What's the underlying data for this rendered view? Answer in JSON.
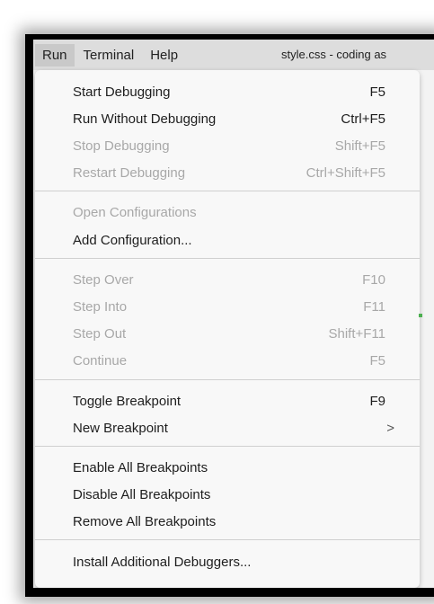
{
  "menubar": {
    "items": [
      "Run",
      "Terminal",
      "Help"
    ],
    "window_title": "style.css - coding as"
  },
  "run_menu": {
    "items": [
      {
        "label": "Start Debugging",
        "shortcut": "F5",
        "disabled": false
      },
      {
        "label": "Run Without Debugging",
        "shortcut": "Ctrl+F5",
        "disabled": false
      },
      {
        "label": "Stop Debugging",
        "shortcut": "Shift+F5",
        "disabled": true
      },
      {
        "label": "Restart Debugging",
        "shortcut": "Ctrl+Shift+F5",
        "disabled": true
      },
      {
        "label": "Open Configurations",
        "shortcut": "",
        "disabled": true
      },
      {
        "label": "Add Configuration...",
        "shortcut": "",
        "disabled": false
      },
      {
        "label": "Step Over",
        "shortcut": "F10",
        "disabled": true
      },
      {
        "label": "Step Into",
        "shortcut": "F11",
        "disabled": true
      },
      {
        "label": "Step Out",
        "shortcut": "Shift+F11",
        "disabled": true
      },
      {
        "label": "Continue",
        "shortcut": "F5",
        "disabled": true
      },
      {
        "label": "Toggle Breakpoint",
        "shortcut": "F9",
        "disabled": false
      },
      {
        "label": "New Breakpoint",
        "submenu_indicator": ">",
        "disabled": false
      },
      {
        "label": "Enable All Breakpoints",
        "shortcut": "",
        "disabled": false
      },
      {
        "label": "Disable All Breakpoints",
        "shortcut": "",
        "disabled": false
      },
      {
        "label": "Remove All Breakpoints",
        "shortcut": "",
        "disabled": false
      },
      {
        "label": "Install Additional Debuggers...",
        "shortcut": "",
        "disabled": false
      }
    ]
  }
}
